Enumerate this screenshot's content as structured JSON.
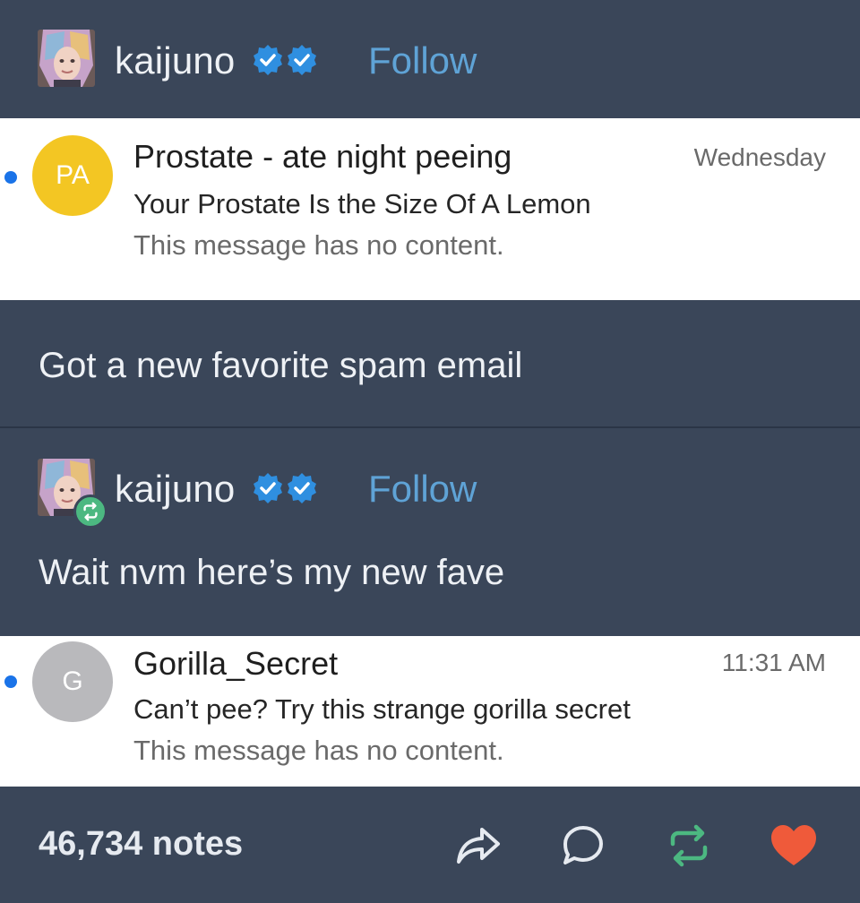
{
  "post": {
    "user": {
      "name": "kaijuno",
      "follow_label": "Follow"
    },
    "caption": "Got a new favorite spam email"
  },
  "email1": {
    "avatar_initials": "PA",
    "avatar_color": "#f3c623",
    "sender": "Prostate - ate night peeing",
    "subject": "Your Prostate Is the Size Of A Lemon",
    "preview": "This message has no content.",
    "time": "Wednesday"
  },
  "reblog": {
    "user": {
      "name": "kaijuno",
      "follow_label": "Follow"
    },
    "caption": "Wait nvm here’s my new fave"
  },
  "email2": {
    "avatar_initials": "G",
    "avatar_color": "#b9b9bc",
    "sender": "Gorilla_Secret",
    "subject": "Can’t pee? Try this strange gorilla secret",
    "preview": "This message has no content.",
    "time": "11:31 AM"
  },
  "footer": {
    "notes": "46,734 notes",
    "actions": [
      "share-icon",
      "reply-icon",
      "reblog-icon",
      "like-icon"
    ],
    "colors": {
      "reblog": "#4cb881",
      "like": "#ef5a3a"
    }
  },
  "colors": {
    "background": "#3a4659",
    "follow": "#5fa3d6",
    "verified": "#2f8fe0",
    "unread": "#1a73e8"
  }
}
